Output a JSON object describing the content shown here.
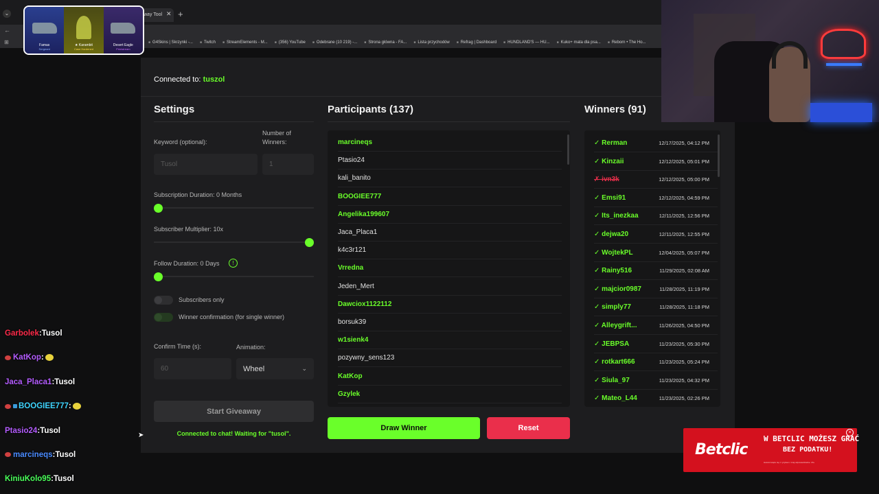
{
  "browser": {
    "tab_title": "way Tool",
    "tab_close": "✕",
    "new_tab": "+",
    "bookmarks": [
      "G4Skins | Skrzynki -...",
      "Twitch",
      "StreamElements - M...",
      "(356) YouTube",
      "Odebrane (10 219) -...",
      "Strona główna - FA...",
      "Lista przychodów",
      "Refrag | Dashboard",
      "HUNDLAND'S — HU...",
      "Kuko+ mata dla psa...",
      "Reborn • The Ho..."
    ]
  },
  "skin_overlay": {
    "items": [
      {
        "name": "Famas",
        "sub": "Sergeant"
      },
      {
        "name": "★ Karambit",
        "sub": "Case Hardened"
      },
      {
        "name": "Desert Eagle",
        "sub": "Printstream"
      }
    ]
  },
  "app": {
    "connected_label": "Connected to:",
    "connected_channel": "tuszol",
    "settings": {
      "title": "Settings",
      "keyword_label": "Keyword (optional):",
      "keyword_placeholder": "Tusol",
      "winners_label": "Number of Winners:",
      "winners_value": "1",
      "sub_duration_label": "Subscription Duration: 0 Months",
      "sub_duration_value": 0,
      "multiplier_label": "Subscriber Multiplier: 10x",
      "multiplier_value": 1.0,
      "follow_label": "Follow Duration: 0 Days",
      "follow_value": 0,
      "info_icon": "!",
      "subs_only_label": "Subscribers only",
      "confirm_toggle_label": "Winner confirmation (for single winner)",
      "confirm_time_label": "Confirm Time (s):",
      "confirm_time_value": "60",
      "animation_label": "Animation:",
      "animation_value": "Wheel",
      "start_button": "Start Giveaway",
      "status": "Connected to chat! Waiting for \"tusol\"."
    },
    "participants": {
      "title": "Participants (137)",
      "list": [
        {
          "name": "marcineqs",
          "sub": true
        },
        {
          "name": "Ptasio24",
          "sub": false
        },
        {
          "name": "kali_banito",
          "sub": false
        },
        {
          "name": "BOOGIEE777",
          "sub": true
        },
        {
          "name": "Angelika199607",
          "sub": true
        },
        {
          "name": "Jaca_Placa1",
          "sub": false
        },
        {
          "name": "k4c3r121",
          "sub": false
        },
        {
          "name": "Vrredna",
          "sub": true
        },
        {
          "name": "Jeden_Mert",
          "sub": false
        },
        {
          "name": "Dawciox1122112",
          "sub": true
        },
        {
          "name": "borsuk39",
          "sub": false
        },
        {
          "name": "w1sienk4",
          "sub": true
        },
        {
          "name": "pozywny_sens123",
          "sub": false
        },
        {
          "name": "KatKop",
          "sub": true
        },
        {
          "name": "Gzylek",
          "sub": true
        }
      ],
      "draw_button": "Draw Winner",
      "reset_button": "Reset"
    },
    "winners": {
      "title": "Winners (91)",
      "list": [
        {
          "mark": "✓",
          "name": "Rerman",
          "date": "12/17/2025, 04:12 PM",
          "rejected": false
        },
        {
          "mark": "✓",
          "name": "Kinzaii",
          "date": "12/12/2025, 05:01 PM",
          "rejected": false
        },
        {
          "mark": "✗",
          "name": "ivn3k",
          "date": "12/12/2025, 05:00 PM",
          "rejected": true
        },
        {
          "mark": "✓",
          "name": "Emsi91",
          "date": "12/12/2025, 04:59 PM",
          "rejected": false
        },
        {
          "mark": "✓",
          "name": "Its_inezkaa",
          "date": "12/11/2025, 12:56 PM",
          "rejected": false
        },
        {
          "mark": "✓",
          "name": "dejwa20",
          "date": "12/11/2025, 12:55 PM",
          "rejected": false
        },
        {
          "mark": "✓",
          "name": "WojtekPL",
          "date": "12/04/2025, 05:07 PM",
          "rejected": false
        },
        {
          "mark": "✓",
          "name": "Rainy516",
          "date": "11/29/2025, 02:08 AM",
          "rejected": false
        },
        {
          "mark": "✓",
          "name": "majcior0987",
          "date": "11/28/2025, 11:19 PM",
          "rejected": false
        },
        {
          "mark": "✓",
          "name": "simply77",
          "date": "11/28/2025, 11:18 PM",
          "rejected": false
        },
        {
          "mark": "✓",
          "name": "Alleygrift...",
          "date": "11/26/2025, 04:50 PM",
          "rejected": false
        },
        {
          "mark": "✓",
          "name": "JEBPSA",
          "date": "11/23/2025, 05:30 PM",
          "rejected": false
        },
        {
          "mark": "✓",
          "name": "rotkart666",
          "date": "11/23/2025, 05:24 PM",
          "rejected": false
        },
        {
          "mark": "✓",
          "name": "Siula_97",
          "date": "11/23/2025, 04:32 PM",
          "rejected": false
        },
        {
          "mark": "✓",
          "name": "Mateo_L44",
          "date": "11/23/2025, 02:26 PM",
          "rejected": false
        }
      ]
    }
  },
  "chat": [
    {
      "user": "Garbolek",
      "color": "#ff2b4a",
      "msg": "Tusol",
      "badge": "",
      "emote": false
    },
    {
      "user": "KatKop",
      "color": "#b45cff",
      "msg": "",
      "badge": "red",
      "emote": true
    },
    {
      "user": "Jaca_Placa1",
      "color": "#b45cff",
      "msg": "Tusol",
      "badge": "",
      "emote": false
    },
    {
      "user": "BOOGIEE777",
      "color": "#3fd5ff",
      "msg": "",
      "badge": "blue",
      "emote": true
    },
    {
      "user": "Ptasio24",
      "color": "#b45cff",
      "msg": "Tusol",
      "badge": "",
      "emote": false
    },
    {
      "user": "marcineqs",
      "color": "#4a8bff",
      "msg": "Tusol",
      "badge": "red",
      "emote": false
    },
    {
      "user": "KiniuKolo95",
      "color": "#4aff5a",
      "msg": "Tusol",
      "badge": "",
      "emote": false
    }
  ],
  "ad": {
    "logo": "Betclic",
    "line1": "W BETCLIC MOŻESZ GRAĆ",
    "line2": "BEZ PODATKU!",
    "close": "×",
    "fine_print": "Hazard wiąże się z ryzykiem. Graj odpowiedzialnie. 18+"
  },
  "colors": {
    "accent": "#6aff2a",
    "danger": "#ea2f4b",
    "panel": "#1d1d1f"
  }
}
